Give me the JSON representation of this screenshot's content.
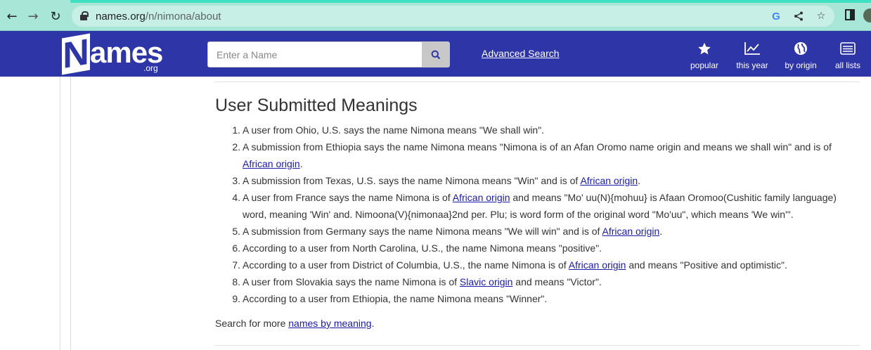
{
  "browser": {
    "url_host": "names.org",
    "url_path": "/n/nimona/about"
  },
  "site": {
    "logo_n": "N",
    "logo_rest": "ames",
    "logo_org": ".org",
    "search_placeholder": "Enter a Name",
    "advanced_search": "Advanced Search",
    "nav": [
      {
        "label": "popular",
        "icon": "star-icon"
      },
      {
        "label": "this year",
        "icon": "trending-chart-icon"
      },
      {
        "label": "by origin",
        "icon": "globe-icon"
      },
      {
        "label": "all lists",
        "icon": "list-icon"
      }
    ],
    "colors": {
      "header": "#2e35a6",
      "link": "#1a1aa6"
    }
  },
  "main": {
    "title": "User Submitted Meanings",
    "items": [
      {
        "num": "1.",
        "parts": [
          {
            "t": "A user from Ohio, U.S. says the name Nimona means \"We shall win\"."
          }
        ]
      },
      {
        "num": "2.",
        "parts": [
          {
            "t": "A submission from Ethiopia says the name Nimona means \"Nimona is of an Afan Oromo name origin and means we shall win\" and is of "
          },
          {
            "link": "African origin"
          },
          {
            "t": "."
          }
        ]
      },
      {
        "num": "3.",
        "parts": [
          {
            "t": "A submission from Texas, U.S. says the name Nimona means \"Win\" and is of "
          },
          {
            "link": "African origin"
          },
          {
            "t": "."
          }
        ]
      },
      {
        "num": "4.",
        "parts": [
          {
            "t": "A user from France says the name Nimona is of "
          },
          {
            "link": "African origin"
          },
          {
            "t": " and means \"Mo' uu(N){mohuu} is Afaan Oromoo(Cushitic family language) word, meaning 'Win' and. Nimoona(V){nimonaa}2nd per. Plu; is word form of the original word \"Mo'uu\", which means 'We win'\"."
          }
        ]
      },
      {
        "num": "5.",
        "parts": [
          {
            "t": "A submission from Germany says the name Nimona means \"We will win\" and is of "
          },
          {
            "link": "African origin"
          },
          {
            "t": "."
          }
        ]
      },
      {
        "num": "6.",
        "parts": [
          {
            "t": "According to a user from North Carolina, U.S., the name Nimona means \"positive\"."
          }
        ]
      },
      {
        "num": "7.",
        "parts": [
          {
            "t": "According to a user from District of Columbia, U.S., the name Nimona is of "
          },
          {
            "link": "African origin"
          },
          {
            "t": " and means \"Positive and optimistic\"."
          }
        ]
      },
      {
        "num": "8.",
        "parts": [
          {
            "t": "A user from Slovakia says the name Nimona is of "
          },
          {
            "link": "Slavic origin"
          },
          {
            "t": " and means \"Victor\"."
          }
        ]
      },
      {
        "num": "9.",
        "parts": [
          {
            "t": "According to a user from Ethiopia, the name Nimona means \"Winner\"."
          }
        ]
      }
    ],
    "more_prefix": "Search for more ",
    "more_link": "names by meaning",
    "more_suffix": "."
  }
}
